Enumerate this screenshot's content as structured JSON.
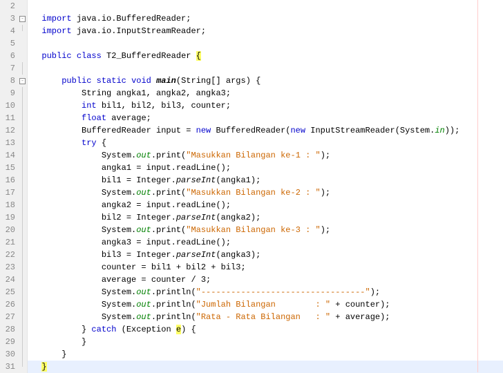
{
  "lines": [
    {
      "num": 2,
      "fold": "",
      "tokens": []
    },
    {
      "num": 3,
      "fold": "box",
      "tokens": [
        {
          "t": "  ",
          "c": ""
        },
        {
          "t": "import",
          "c": "kw"
        },
        {
          "t": " java.io.BufferedReader;",
          "c": ""
        }
      ]
    },
    {
      "num": 4,
      "fold": "end",
      "tokens": [
        {
          "t": "  ",
          "c": ""
        },
        {
          "t": "import",
          "c": "kw"
        },
        {
          "t": " java.io.InputStreamReader;",
          "c": ""
        }
      ]
    },
    {
      "num": 5,
      "fold": "",
      "tokens": []
    },
    {
      "num": 6,
      "fold": "",
      "tokens": [
        {
          "t": "  ",
          "c": ""
        },
        {
          "t": "public",
          "c": "kw"
        },
        {
          "t": " ",
          "c": ""
        },
        {
          "t": "class",
          "c": "kw"
        },
        {
          "t": " T2_BufferedReader ",
          "c": ""
        },
        {
          "t": "{",
          "c": "hl"
        }
      ]
    },
    {
      "num": 7,
      "fold": "line",
      "tokens": []
    },
    {
      "num": 8,
      "fold": "box",
      "tokens": [
        {
          "t": "      ",
          "c": ""
        },
        {
          "t": "public",
          "c": "kw"
        },
        {
          "t": " ",
          "c": ""
        },
        {
          "t": "static",
          "c": "kw"
        },
        {
          "t": " ",
          "c": ""
        },
        {
          "t": "void",
          "c": "kw"
        },
        {
          "t": " ",
          "c": ""
        },
        {
          "t": "main",
          "c": "mtd"
        },
        {
          "t": "(String[] args) {",
          "c": ""
        }
      ]
    },
    {
      "num": 9,
      "fold": "line",
      "tokens": [
        {
          "t": "          String angka1, angka2, angka3;",
          "c": ""
        }
      ]
    },
    {
      "num": 10,
      "fold": "line",
      "tokens": [
        {
          "t": "          ",
          "c": ""
        },
        {
          "t": "int",
          "c": "kw"
        },
        {
          "t": " bil1, bil2, bil3, counter;",
          "c": ""
        }
      ]
    },
    {
      "num": 11,
      "fold": "line",
      "tokens": [
        {
          "t": "          ",
          "c": ""
        },
        {
          "t": "float",
          "c": "kw"
        },
        {
          "t": " average;",
          "c": ""
        }
      ]
    },
    {
      "num": 12,
      "fold": "line",
      "tokens": [
        {
          "t": "          BufferedReader input = ",
          "c": ""
        },
        {
          "t": "new",
          "c": "kw"
        },
        {
          "t": " BufferedReader(",
          "c": ""
        },
        {
          "t": "new",
          "c": "kw"
        },
        {
          "t": " InputStreamReader(System.",
          "c": ""
        },
        {
          "t": "in",
          "c": "fld"
        },
        {
          "t": "));",
          "c": ""
        }
      ]
    },
    {
      "num": 13,
      "fold": "line",
      "tokens": [
        {
          "t": "          ",
          "c": ""
        },
        {
          "t": "try",
          "c": "kw"
        },
        {
          "t": " {",
          "c": ""
        }
      ]
    },
    {
      "num": 14,
      "fold": "line",
      "tokens": [
        {
          "t": "              System.",
          "c": ""
        },
        {
          "t": "out",
          "c": "fld"
        },
        {
          "t": ".print(",
          "c": ""
        },
        {
          "t": "\"Masukkan Bilangan ke-1 : \"",
          "c": "str"
        },
        {
          "t": ");",
          "c": ""
        }
      ]
    },
    {
      "num": 15,
      "fold": "line",
      "tokens": [
        {
          "t": "              angka1 = input.readLine();",
          "c": ""
        }
      ]
    },
    {
      "num": 16,
      "fold": "line",
      "tokens": [
        {
          "t": "              bil1 = Integer.",
          "c": ""
        },
        {
          "t": "parseInt",
          "c": "smtd"
        },
        {
          "t": "(angka1);",
          "c": ""
        }
      ]
    },
    {
      "num": 17,
      "fold": "line",
      "tokens": [
        {
          "t": "              System.",
          "c": ""
        },
        {
          "t": "out",
          "c": "fld"
        },
        {
          "t": ".print(",
          "c": ""
        },
        {
          "t": "\"Masukkan Bilangan ke-2 : \"",
          "c": "str"
        },
        {
          "t": ");",
          "c": ""
        }
      ]
    },
    {
      "num": 18,
      "fold": "line",
      "tokens": [
        {
          "t": "              angka2 = input.readLine();",
          "c": ""
        }
      ]
    },
    {
      "num": 19,
      "fold": "line",
      "tokens": [
        {
          "t": "              bil2 = Integer.",
          "c": ""
        },
        {
          "t": "parseInt",
          "c": "smtd"
        },
        {
          "t": "(angka2);",
          "c": ""
        }
      ]
    },
    {
      "num": 20,
      "fold": "line",
      "tokens": [
        {
          "t": "              System.",
          "c": ""
        },
        {
          "t": "out",
          "c": "fld"
        },
        {
          "t": ".print(",
          "c": ""
        },
        {
          "t": "\"Masukkan Bilangan ke-3 : \"",
          "c": "str"
        },
        {
          "t": ");",
          "c": ""
        }
      ]
    },
    {
      "num": 21,
      "fold": "line",
      "tokens": [
        {
          "t": "              angka3 = input.readLine();",
          "c": ""
        }
      ]
    },
    {
      "num": 22,
      "fold": "line",
      "tokens": [
        {
          "t": "              bil3 = Integer.",
          "c": ""
        },
        {
          "t": "parseInt",
          "c": "smtd"
        },
        {
          "t": "(angka3);",
          "c": ""
        }
      ]
    },
    {
      "num": 23,
      "fold": "line",
      "tokens": [
        {
          "t": "              counter = bil1 + bil2 + bil3;",
          "c": ""
        }
      ]
    },
    {
      "num": 24,
      "fold": "line",
      "tokens": [
        {
          "t": "              average = counter / 3;",
          "c": ""
        }
      ]
    },
    {
      "num": 25,
      "fold": "line",
      "tokens": [
        {
          "t": "              System.",
          "c": ""
        },
        {
          "t": "out",
          "c": "fld"
        },
        {
          "t": ".println(",
          "c": ""
        },
        {
          "t": "\"---------------------------------\"",
          "c": "str"
        },
        {
          "t": ");",
          "c": ""
        }
      ]
    },
    {
      "num": 26,
      "fold": "line",
      "tokens": [
        {
          "t": "              System.",
          "c": ""
        },
        {
          "t": "out",
          "c": "fld"
        },
        {
          "t": ".println(",
          "c": ""
        },
        {
          "t": "\"Jumlah Bilangan        : \"",
          "c": "str"
        },
        {
          "t": " + counter);",
          "c": ""
        }
      ]
    },
    {
      "num": 27,
      "fold": "line",
      "tokens": [
        {
          "t": "              System.",
          "c": ""
        },
        {
          "t": "out",
          "c": "fld"
        },
        {
          "t": ".println(",
          "c": ""
        },
        {
          "t": "\"Rata - Rata Bilangan   : \"",
          "c": "str"
        },
        {
          "t": " + average);",
          "c": ""
        }
      ]
    },
    {
      "num": 28,
      "fold": "line",
      "tokens": [
        {
          "t": "          } ",
          "c": ""
        },
        {
          "t": "catch",
          "c": "kw"
        },
        {
          "t": " (Exception ",
          "c": ""
        },
        {
          "t": "e",
          "c": "hl"
        },
        {
          "t": ") {",
          "c": ""
        }
      ]
    },
    {
      "num": 29,
      "fold": "line",
      "tokens": [
        {
          "t": "          }",
          "c": ""
        }
      ]
    },
    {
      "num": 30,
      "fold": "line",
      "tokens": [
        {
          "t": "      }",
          "c": ""
        }
      ]
    },
    {
      "num": 31,
      "fold": "end",
      "current": true,
      "tokens": [
        {
          "t": "  ",
          "c": ""
        },
        {
          "t": "}",
          "c": "hl"
        }
      ]
    }
  ]
}
